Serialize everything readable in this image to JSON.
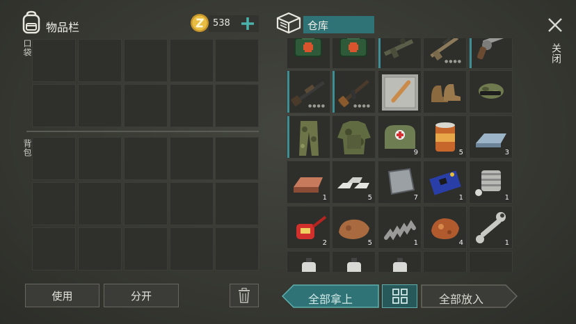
{
  "header": {
    "inventory_title": "物品栏",
    "coins": "538",
    "storage_title": "仓库",
    "close_label": "关闭"
  },
  "left_panel": {
    "pocket_label": "口袋",
    "backpack_label": "背包"
  },
  "buttons": {
    "use": "使用",
    "split": "分开",
    "take_all": "全部拿上",
    "put_all": "全部放入"
  },
  "storage": {
    "rows": [
      [
        {
          "item": "first-aid-kit-icon",
          "qty": ""
        },
        {
          "item": "first-aid-kit-icon",
          "qty": ""
        },
        {
          "item": "rifle-icon",
          "qty": ""
        },
        {
          "item": "sniper-rifle-icon",
          "qty": ""
        },
        {
          "item": "revolver-icon",
          "qty": ""
        }
      ],
      [
        {
          "item": "shotgun-icon",
          "qty": ""
        },
        {
          "item": "assault-rifle-icon",
          "qty": ""
        },
        {
          "item": "baseball-bat-icon",
          "qty": ""
        },
        {
          "item": "boots-icon",
          "qty": ""
        },
        {
          "item": "camo-cap-icon",
          "qty": ""
        }
      ],
      [
        {
          "item": "camo-pants-icon",
          "qty": ""
        },
        {
          "item": "camo-jacket-icon",
          "qty": ""
        },
        {
          "item": "medical-bag-icon",
          "qty": "9"
        },
        {
          "item": "canned-food-icon",
          "qty": "5"
        },
        {
          "item": "metal-ingot-icon",
          "qty": "3"
        }
      ],
      [
        {
          "item": "copper-ingot-icon",
          "qty": "1"
        },
        {
          "item": "aluminum-bars-icon",
          "qty": "5"
        },
        {
          "item": "metal-plate-icon",
          "qty": "7"
        },
        {
          "item": "circuit-board-icon",
          "qty": "1"
        },
        {
          "item": "engine-part-icon",
          "qty": "1"
        }
      ],
      [
        {
          "item": "oil-can-icon",
          "qty": "2"
        },
        {
          "item": "stone-icon",
          "qty": "5"
        },
        {
          "item": "spring-icon",
          "qty": "1"
        },
        {
          "item": "iron-ore-icon",
          "qty": "4"
        },
        {
          "item": "wrench-icon",
          "qty": "1"
        }
      ],
      [
        {
          "item": "spray-can-red-icon",
          "qty": ""
        },
        {
          "item": "spray-can-red-icon",
          "qty": ""
        },
        {
          "item": "spray-can-yellow-icon",
          "qty": ""
        },
        {
          "item": "",
          "qty": ""
        },
        {
          "item": "",
          "qty": ""
        }
      ]
    ]
  },
  "colors": {
    "accent": "#3d8f95",
    "coin": "#e1b43a",
    "storage_tab_bg": "#2f7376",
    "take_all_bg": "#2f7376"
  }
}
